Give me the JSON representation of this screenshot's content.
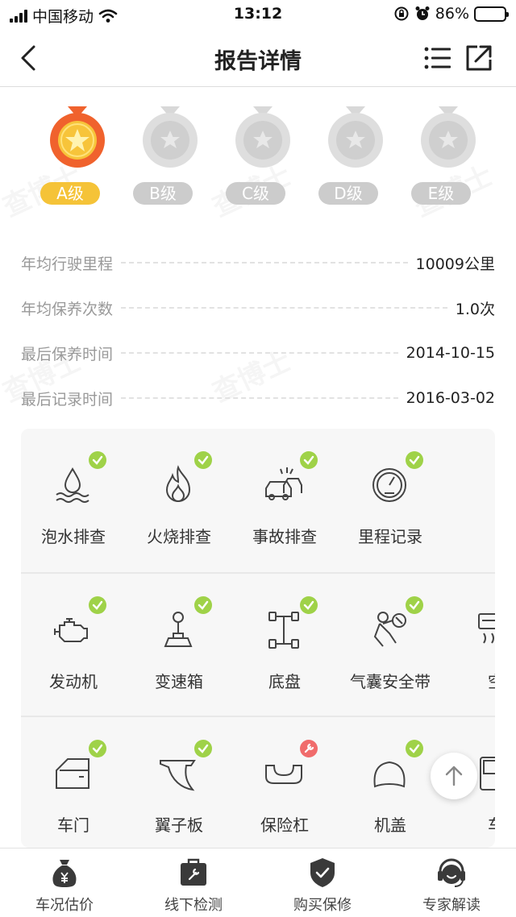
{
  "status_bar": {
    "carrier": "中国移动",
    "time": "13:12",
    "battery": "86%",
    "battery_level": 0.86,
    "icons": [
      "signal-icon",
      "wifi-icon",
      "orientation-lock-icon",
      "alarm-icon",
      "battery-icon"
    ]
  },
  "nav": {
    "title": "报告详情",
    "back_icon": "chevron-left-icon",
    "list_icon": "list-icon",
    "share_icon": "share-icon"
  },
  "grades": [
    {
      "label": "A级",
      "active": true
    },
    {
      "label": "B级",
      "active": false
    },
    {
      "label": "C级",
      "active": false
    },
    {
      "label": "D级",
      "active": false
    },
    {
      "label": "E级",
      "active": false
    }
  ],
  "info": [
    {
      "label": "年均行驶里程",
      "value": "10009公里"
    },
    {
      "label": "年均保养次数",
      "value": "1.0次"
    },
    {
      "label": "最后保养时间",
      "value": "2014-10-15"
    },
    {
      "label": "最后记录时间",
      "value": "2016-03-02"
    }
  ],
  "checks": [
    [
      {
        "label": "泡水排查",
        "icon": "water-drop-icon",
        "status": "ok"
      },
      {
        "label": "火烧排查",
        "icon": "fire-icon",
        "status": "ok"
      },
      {
        "label": "事故排查",
        "icon": "car-crash-icon",
        "status": "ok"
      },
      {
        "label": "里程记录",
        "icon": "odometer-icon",
        "status": "ok"
      }
    ],
    [
      {
        "label": "发动机",
        "icon": "engine-icon",
        "status": "ok"
      },
      {
        "label": "变速箱",
        "icon": "gear-stick-icon",
        "status": "ok"
      },
      {
        "label": "底盘",
        "icon": "chassis-icon",
        "status": "ok"
      },
      {
        "label": "气囊安全带",
        "icon": "airbag-icon",
        "status": "ok"
      },
      {
        "label": "空",
        "icon": "air-conditioner-icon",
        "status": "none"
      }
    ],
    [
      {
        "label": "车门",
        "icon": "car-door-icon",
        "status": "ok"
      },
      {
        "label": "翼子板",
        "icon": "fender-icon",
        "status": "ok"
      },
      {
        "label": "保险杠",
        "icon": "bumper-icon",
        "status": "warn"
      },
      {
        "label": "机盖",
        "icon": "hood-icon",
        "status": "ok"
      },
      {
        "label": "车",
        "icon": "car-part-icon",
        "status": "none"
      }
    ]
  ],
  "tabs": [
    {
      "label": "车况估价",
      "icon": "money-bag-icon"
    },
    {
      "label": "线下检测",
      "icon": "toolbox-icon"
    },
    {
      "label": "购买保修",
      "icon": "shield-check-icon"
    },
    {
      "label": "专家解读",
      "icon": "headset-icon"
    }
  ],
  "colors": {
    "accent": "#f5c338",
    "ok_badge": "#9fd248",
    "warn_badge": "#f06b6b",
    "medal_active": "#f0622d",
    "medal_inactive": "#d8d8d8"
  }
}
